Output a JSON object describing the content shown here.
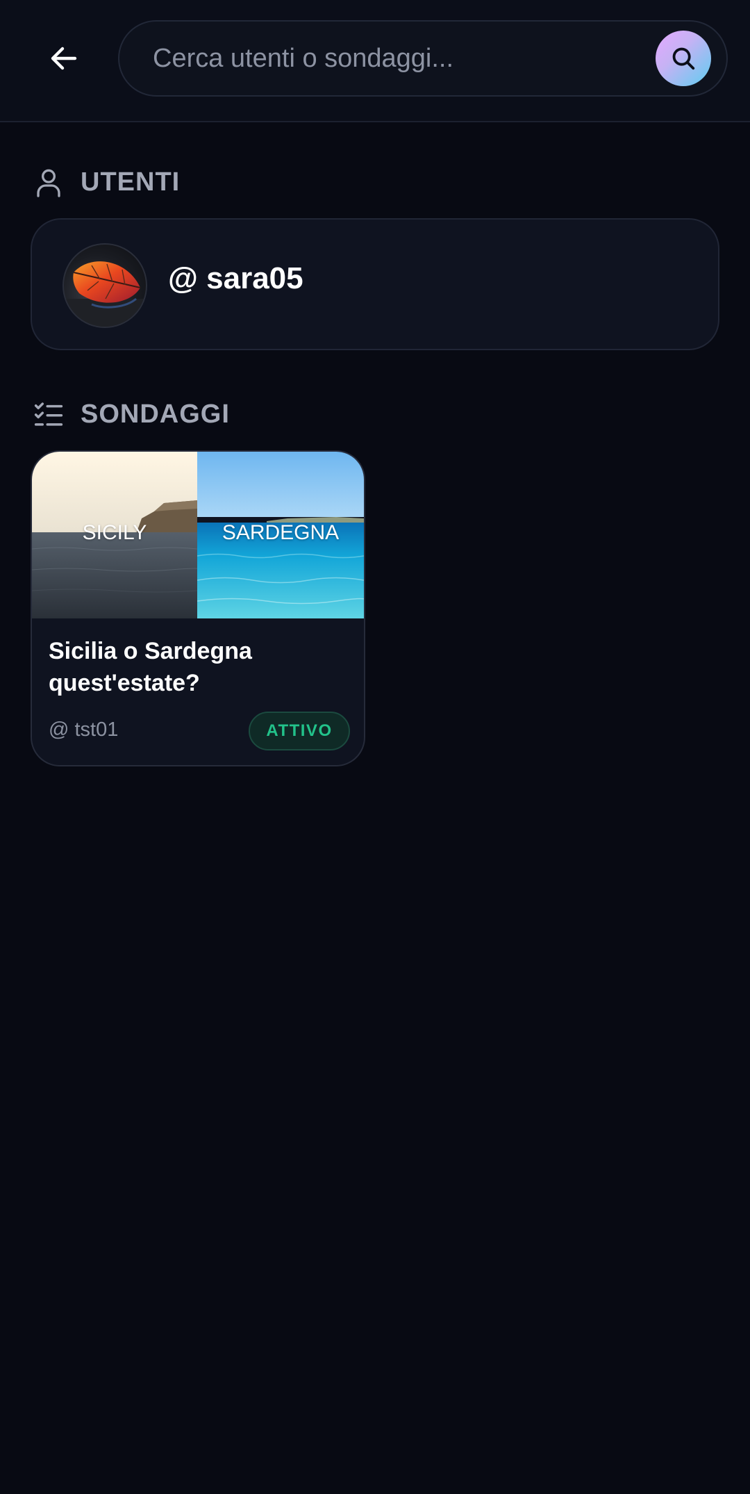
{
  "search": {
    "placeholder": "Cerca utenti o sondaggi...",
    "value": ""
  },
  "sections": {
    "users_title": "UTENTI",
    "polls_title": "SONDAGGI"
  },
  "users": [
    {
      "username": "@ sara05"
    }
  ],
  "polls": [
    {
      "image_left_label": "SICILY",
      "image_right_label": "SARDEGNA",
      "title": "Sicilia o Sardegna quest'estate?",
      "author": "@ tst01",
      "status": "ATTIVO"
    }
  ],
  "colors": {
    "background": "#080a13",
    "card": "#0f1320",
    "status_active": "#22c28a",
    "search_gradient_start": "#e4a8ff",
    "search_gradient_end": "#5fcdf0"
  },
  "icons": {
    "back": "arrow-left-icon",
    "search": "search-icon",
    "users_section": "user-icon",
    "polls_section": "checklist-icon"
  }
}
